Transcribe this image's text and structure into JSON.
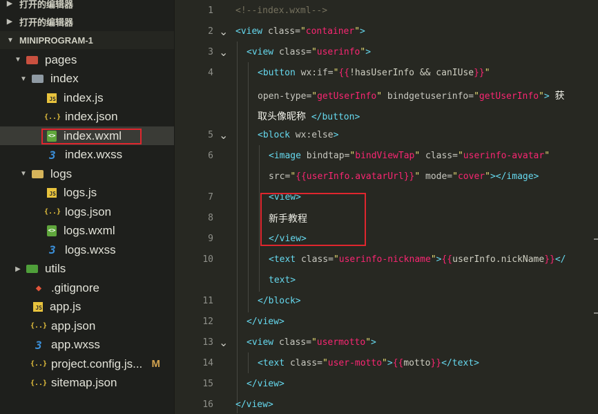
{
  "sidebar": {
    "open_editors_label": "打开的编辑器",
    "project_label": "MINIPROGRAM-1",
    "tree": [
      {
        "label": "pages",
        "type": "folder-red"
      },
      {
        "label": "index",
        "type": "folder-open"
      },
      {
        "label": "index.js",
        "type": "js"
      },
      {
        "label": "index.json",
        "type": "json"
      },
      {
        "label": "index.wxml",
        "type": "wxml",
        "selected": true
      },
      {
        "label": "index.wxss",
        "type": "wxss"
      },
      {
        "label": "logs",
        "type": "folder-open-yellow"
      },
      {
        "label": "logs.js",
        "type": "js"
      },
      {
        "label": "logs.json",
        "type": "json"
      },
      {
        "label": "logs.wxml",
        "type": "wxml"
      },
      {
        "label": "logs.wxss",
        "type": "wxss"
      },
      {
        "label": "utils",
        "type": "folder-green"
      },
      {
        "label": ".gitignore",
        "type": "git"
      },
      {
        "label": "app.js",
        "type": "js"
      },
      {
        "label": "app.json",
        "type": "json"
      },
      {
        "label": "app.wxss",
        "type": "wxss"
      },
      {
        "label": "project.config.js...",
        "type": "json",
        "badge": "M"
      },
      {
        "label": "sitemap.json",
        "type": "json"
      }
    ]
  },
  "editor": {
    "line_numbers": [
      "1",
      "2",
      "3",
      "4",
      "5",
      "6",
      "7",
      "8",
      "9",
      "10",
      "11",
      "12",
      "13",
      "14",
      "15",
      "16"
    ],
    "zh_get_avatar_1": "获",
    "zh_get_avatar_2": "取头像昵称",
    "zh_tutorial": "新手教程"
  },
  "icons": {
    "js": "js-file-icon",
    "json": "json-file-icon",
    "wxml": "wxml-file-icon",
    "wxss": "css-file-icon",
    "git": "git-icon",
    "folder": "folder-icon"
  },
  "colors": {
    "accent_red_outline": "#e0262e",
    "editor_bg": "#272822",
    "sidebar_bg": "#1e1f1c"
  }
}
